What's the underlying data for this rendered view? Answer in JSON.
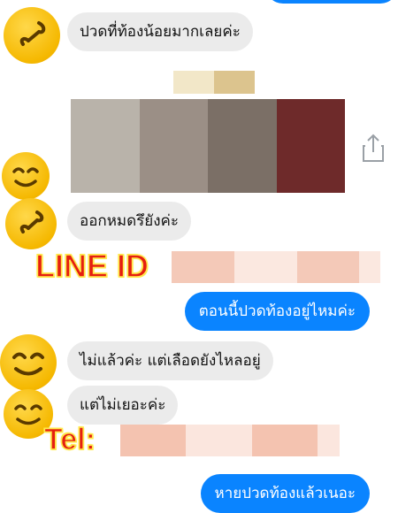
{
  "messages": [
    {
      "id": "m1",
      "direction": "incoming",
      "text": "ปวดที่ท้องน้อยมากเลยค่ะ"
    },
    {
      "id": "m2",
      "direction": "incoming",
      "text": "ออกหมดรึยังค่ะ"
    },
    {
      "id": "m3",
      "direction": "outgoing",
      "text": "ตอนนี้ปวดท้องอยู่ไหมค่ะ"
    },
    {
      "id": "m4",
      "direction": "incoming",
      "text": "ไม่แล้วค่ะ แต่เลือดยังไหลอยู่"
    },
    {
      "id": "m5",
      "direction": "incoming",
      "text": "แต่ไม่เยอะค่ะ"
    },
    {
      "id": "m6",
      "direction": "outgoing",
      "text": "หายปวดท้องแล้วเนอะ"
    }
  ],
  "overlays": {
    "line_label": "LINE ID",
    "tel_label": "Tel:"
  },
  "icons": {
    "share": "share-icon",
    "emoji": "smiling-emoji-icon"
  },
  "colors": {
    "outgoing_bubble": "#0a84ff",
    "incoming_bubble": "#ebebeb",
    "overlay_red": "#e51f10",
    "overlay_outline": "#ffe94d"
  }
}
